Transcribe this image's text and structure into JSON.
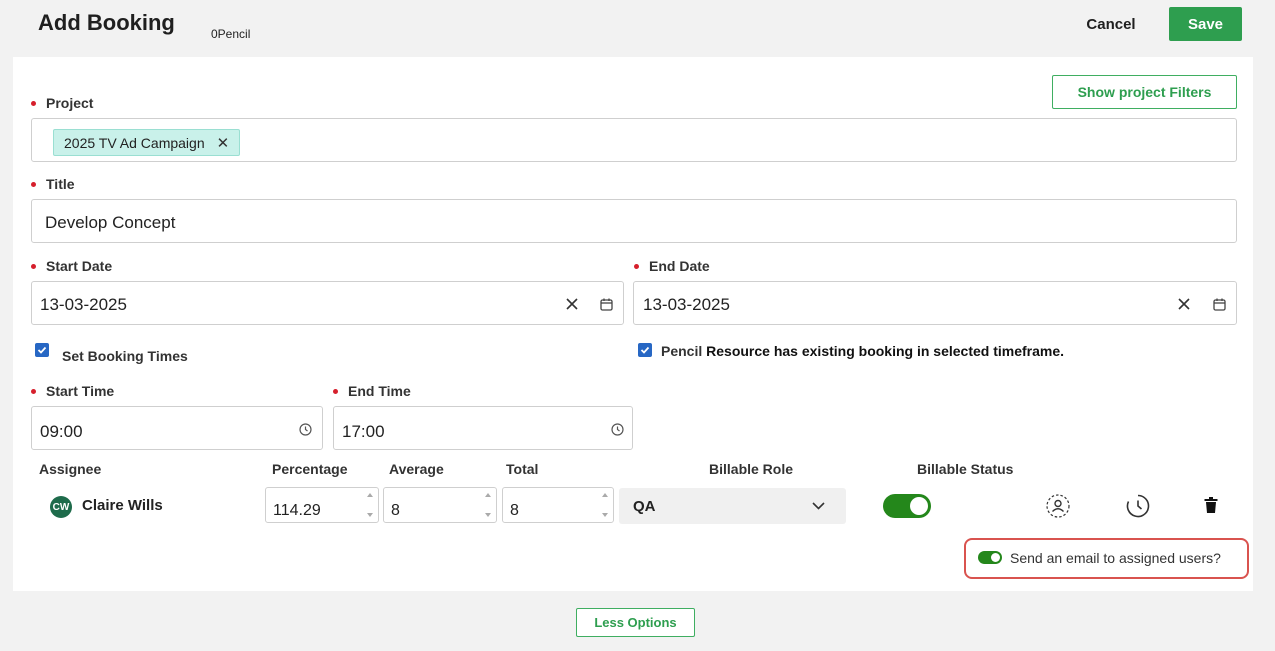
{
  "header": {
    "title": "Add Booking",
    "subtitle": "0Pencil",
    "cancel_label": "Cancel",
    "save_label": "Save"
  },
  "form": {
    "show_filters_label": "Show project Filters",
    "project": {
      "label": "Project",
      "tag": "2025 TV Ad Campaign"
    },
    "title": {
      "label": "Title",
      "value": "Develop Concept"
    },
    "start_date": {
      "label": "Start Date",
      "value": "13-03-2025"
    },
    "end_date": {
      "label": "End Date",
      "value": "13-03-2025"
    },
    "set_booking_times": {
      "label": "Set Booking Times",
      "checked": true
    },
    "existing_booking": {
      "prefix": "Pencil",
      "label": "Resource has existing booking in selected timeframe.",
      "checked": true
    },
    "start_time": {
      "label": "Start Time",
      "value": "09:00"
    },
    "end_time": {
      "label": "End Time",
      "value": "17:00"
    }
  },
  "assignees": {
    "columns": {
      "assignee": "Assignee",
      "percentage": "Percentage",
      "average": "Average",
      "total": "Total",
      "billable_role": "Billable Role",
      "billable_status": "Billable Status"
    },
    "rows": [
      {
        "initials": "CW",
        "name": "Claire Wills",
        "percentage": "114.29",
        "average": "8",
        "total": "8",
        "billable_role": "QA",
        "billable_status": true
      }
    ]
  },
  "email_toggle": {
    "label": "Send an email to assigned users?",
    "on": true
  },
  "less_options_label": "Less Options",
  "colors": {
    "accent_green": "#2e9e4f",
    "toggle_green": "#24871b",
    "required_red": "#d61f2c",
    "checkbox_blue": "#2767c4",
    "highlight_red": "#d9534f",
    "tag_bg": "#c9f1ea"
  }
}
